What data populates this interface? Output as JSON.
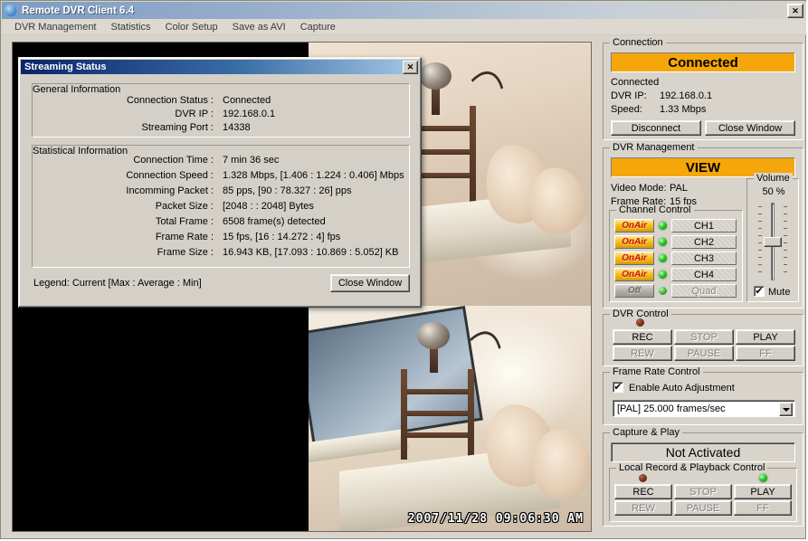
{
  "window": {
    "title": "Remote DVR Client 6.4",
    "close_label": "✕",
    "icon": "app-globe-icon"
  },
  "menubar": {
    "items": [
      {
        "label": "DVR Management"
      },
      {
        "label": "Statistics"
      },
      {
        "label": "Color Setup"
      },
      {
        "label": "Save as AVI"
      },
      {
        "label": "Capture"
      }
    ]
  },
  "video": {
    "timestamp": "2007/11/28 09:06:30 AM",
    "layout": "quad",
    "quadrants": [
      {
        "name": "channel-1",
        "state": "black"
      },
      {
        "name": "channel-2",
        "state": "live"
      },
      {
        "name": "channel-3",
        "state": "black"
      },
      {
        "name": "channel-4",
        "state": "live"
      }
    ]
  },
  "dialog": {
    "title": "Streaming Status",
    "close_label": "✕",
    "general": {
      "legend": "General Information",
      "rows": [
        {
          "label": "Connection Status :",
          "value": "Connected"
        },
        {
          "label": "DVR IP :",
          "value": "192.168.0.1"
        },
        {
          "label": "Streaming Port :",
          "value": "14338"
        }
      ]
    },
    "statistical": {
      "legend": "Statistical Information",
      "rows": [
        {
          "label": "Connection Time :",
          "value": "7 min 36 sec"
        },
        {
          "label": "Connection Speed :",
          "value": "1.328 Mbps, [1.406 : 1.224 : 0.406] Mbps"
        },
        {
          "label": "Incomming Packet :",
          "value": "85 pps, [90 : 78.327 : 26] pps"
        },
        {
          "label": "Packet Size :",
          "value": "[2048 : : 2048] Bytes"
        },
        {
          "label": "Total Frame :",
          "value": "6508 frame(s) detected"
        },
        {
          "label": "Frame Rate :",
          "value": "15 fps, [16 : 14.272 : 4] fps"
        },
        {
          "label": "Frame Size :",
          "value": "16.943 KB, [17.093 : 10.869 : 5.052] KB"
        }
      ]
    },
    "legend_text": "Legend: Current [Max : Average : Min]",
    "close_button": "Close Window"
  },
  "connection": {
    "legend": "Connection",
    "banner": "Connected",
    "banner_color": "#f5a60a",
    "status": "Connected",
    "ip_label": "DVR IP:",
    "ip_value": "192.168.0.1",
    "speed_label": "Speed:",
    "speed_value": "1.33 Mbps",
    "disconnect_button": "Disconnect",
    "close_button": "Close Window"
  },
  "dvr_management": {
    "legend": "DVR Management",
    "banner": "VIEW",
    "video_mode_label": "Video Mode:",
    "video_mode_value": "PAL",
    "frame_rate_label": "Frame Rate:",
    "frame_rate_value": "15 fps",
    "channel_control": {
      "legend": "Channel Control",
      "rows": [
        {
          "state_label": "OnAir",
          "state": "on",
          "led": "green",
          "channel": "CH1",
          "enabled": true
        },
        {
          "state_label": "OnAir",
          "state": "on",
          "led": "green",
          "channel": "CH2",
          "enabled": true
        },
        {
          "state_label": "OnAir",
          "state": "on",
          "led": "green",
          "channel": "CH3",
          "enabled": true
        },
        {
          "state_label": "OnAir",
          "state": "on",
          "led": "green",
          "channel": "CH4",
          "enabled": true
        },
        {
          "state_label": "Off",
          "state": "off",
          "led": "green",
          "channel": "Quad",
          "enabled": false
        }
      ]
    },
    "volume": {
      "legend": "Volume",
      "value": "50 %",
      "percent": 50,
      "mute_label": "Mute",
      "mute_checked": true,
      "check_glyph": "✔"
    }
  },
  "dvr_control": {
    "legend": "DVR Control",
    "led": "darkred",
    "buttons": [
      {
        "label": "REC",
        "enabled": true
      },
      {
        "label": "STOP",
        "enabled": false
      },
      {
        "label": "PLAY",
        "enabled": true
      },
      {
        "label": "REW",
        "enabled": false
      },
      {
        "label": "PAUSE",
        "enabled": false
      },
      {
        "label": "FF",
        "enabled": false
      }
    ]
  },
  "frame_rate_control": {
    "legend": "Frame Rate Control",
    "auto_label": "Enable Auto Adjustment",
    "auto_checked": true,
    "check_glyph": "✔",
    "selected_option": "[PAL] 25.000 frames/sec"
  },
  "capture_play": {
    "legend": "Capture & Play",
    "status": "Not Activated",
    "local": {
      "legend": "Local Record & Playback Control",
      "rec_led": "darkred",
      "play_led": "green",
      "buttons": [
        {
          "label": "REC",
          "enabled": true
        },
        {
          "label": "STOP",
          "enabled": false
        },
        {
          "label": "PLAY",
          "enabled": true
        },
        {
          "label": "REW",
          "enabled": false
        },
        {
          "label": "PAUSE",
          "enabled": false
        },
        {
          "label": "FF",
          "enabled": false
        }
      ]
    }
  }
}
